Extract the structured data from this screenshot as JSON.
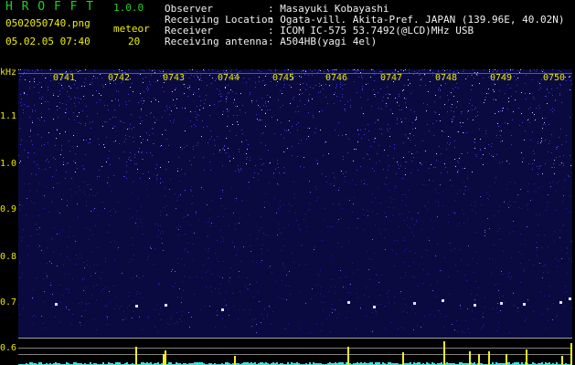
{
  "header": {
    "app_title": "H R O F F T",
    "version": "1.0.0",
    "file_name": "0502050740.png",
    "datetime": "05.02.05 07:40",
    "meteor_label": "meteor",
    "meteor_count": "20"
  },
  "info": [
    {
      "label": "Observer",
      "value": ": Masayuki Kobayashi"
    },
    {
      "label": "Receiving Location",
      "value": ": Ogata-vill. Akita-Pref. JAPAN (139.96E, 40.02N)"
    },
    {
      "label": "Receiver",
      "value": ": ICOM IC-575 53.7492(@LCD)MHz USB"
    },
    {
      "label": "Receiving antenna",
      "value": ": A504HB(yagi 4el)"
    }
  ],
  "yaxis": {
    "unit": "kHz",
    "ticks": [
      "1.1",
      "1.0",
      "0.9",
      "0.8",
      "0.7",
      "0.6"
    ]
  },
  "xaxis": {
    "ticks": [
      "0741",
      "0742",
      "0743",
      "0744",
      "0745",
      "0746",
      "0747",
      "0748",
      "0749",
      "0750"
    ]
  },
  "colors": {
    "background": "#000000",
    "spectrum": "#0a0a40",
    "title": "#20d020",
    "labels": "#f0f000"
  }
}
